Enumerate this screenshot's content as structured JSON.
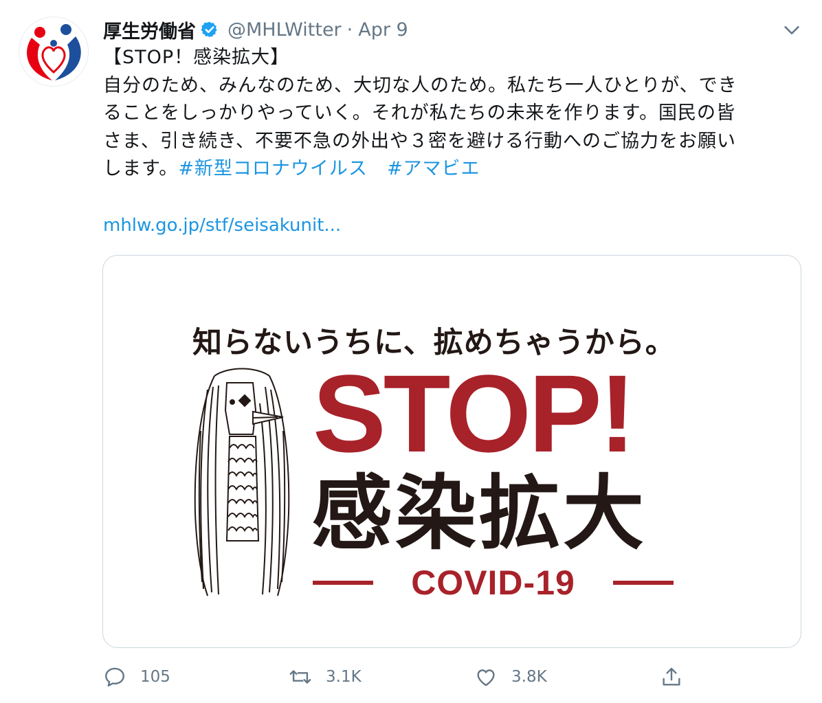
{
  "account": {
    "display_name": "厚生労働省",
    "handle": "@MHLWitter",
    "separator": "·",
    "date": "Apr 9"
  },
  "tweet": {
    "title": "【STOP！感染拡大】",
    "body_lines": [
      "自分のため、みんなのため、大切な人のため。私たち一人ひとりが、でき",
      "ることをしっかりやっていく。それが私たちの未来を作ります。国民の皆",
      "さま、引き続き、不要不急の外出や３密を避ける行動へのご協力をお願い"
    ],
    "last_line_prefix": "します。",
    "hashtags": [
      "#新型コロナウイルス",
      "#アマビエ"
    ],
    "link": "mhlw.go.jp/stf/seisakunit..."
  },
  "card": {
    "tagline": "知らないうちに、拡めちゃうから。",
    "stop": "STOP!",
    "kanji": "感染拡大",
    "covid": "COVID-19"
  },
  "actions": {
    "reply_count": "105",
    "retweet_count": "3.1K",
    "like_count": "3.8K"
  },
  "colors": {
    "link_blue": "#1b95e0",
    "secondary_gray": "#657786",
    "verified_blue": "#1da1f2",
    "stop_red": "#a8222a",
    "text_dark": "#14171a"
  },
  "icons": [
    "avatar-logo",
    "verified-badge-icon",
    "chevron-down-icon",
    "reply-icon",
    "retweet-icon",
    "like-icon",
    "share-icon"
  ]
}
